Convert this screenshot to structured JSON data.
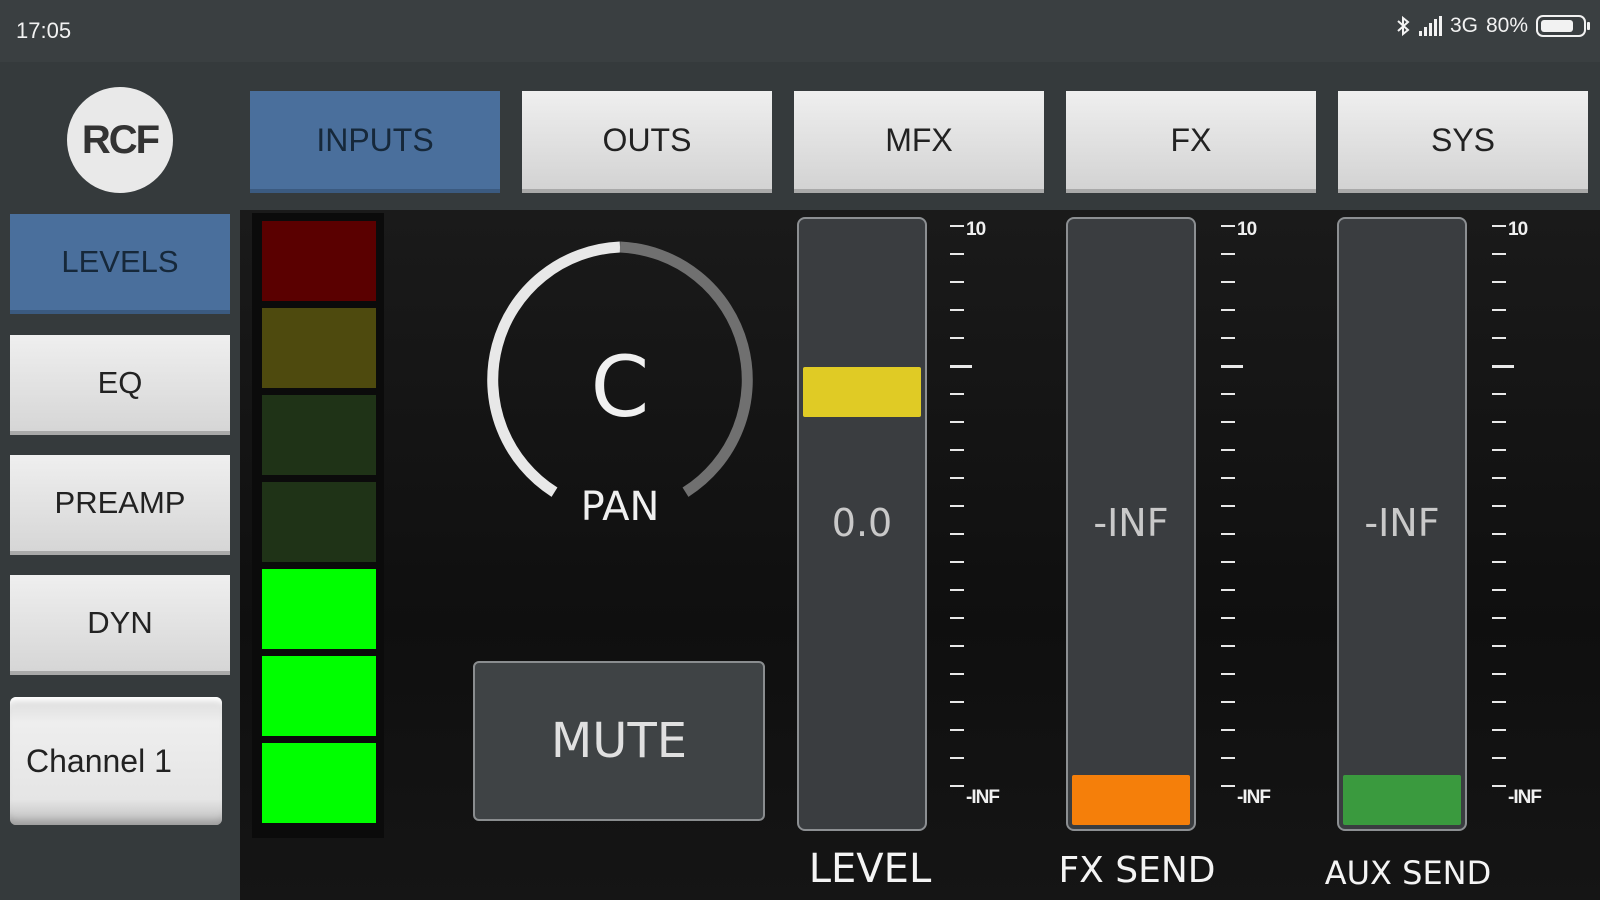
{
  "status_bar": {
    "time": "17:05",
    "network": "3G",
    "battery": "80%",
    "battery_level": 0.8,
    "icons": [
      "bluetooth-icon",
      "signal-icon",
      "battery-icon"
    ]
  },
  "logo": {
    "text": "RCF"
  },
  "tabs": [
    {
      "label": "INPUTS",
      "active": true
    },
    {
      "label": "OUTS",
      "active": false
    },
    {
      "label": "MFX",
      "active": false
    },
    {
      "label": "FX",
      "active": false
    },
    {
      "label": "SYS",
      "active": false
    }
  ],
  "side_menu": [
    {
      "label": "LEVELS",
      "active": true
    },
    {
      "label": "EQ",
      "active": false
    },
    {
      "label": "PREAMP",
      "active": false
    },
    {
      "label": "DYN",
      "active": false
    }
  ],
  "channel": {
    "label": "Channel 1"
  },
  "meter": {
    "segment_colors_top_to_bottom": [
      "#5a0000",
      "#4e4a0e",
      "#1f3317",
      "#1f3317",
      "#00ff00",
      "#00ff00",
      "#00ff00"
    ],
    "lit_segments": 3,
    "total_segments": 7
  },
  "pan": {
    "value": "C",
    "label": "PAN"
  },
  "mute": {
    "label": "MUTE"
  },
  "faders": [
    {
      "label": "LEVEL",
      "value": "0.0",
      "position": 0.74,
      "handle_color": "#e0cb25",
      "scale_top": "10",
      "scale_bottom": "-INF"
    },
    {
      "label": "FX SEND",
      "value": "-INF",
      "position": 0.0,
      "handle_color": "#f57f0a",
      "scale_top": "10",
      "scale_bottom": "-INF"
    },
    {
      "label": "AUX SEND",
      "value": "-INF",
      "position": 0.0,
      "handle_color": "#3a9a3e",
      "scale_top": "10",
      "scale_bottom": "-INF"
    }
  ],
  "colors": {
    "accent_blue": "#4a6f9c",
    "background": "#1c1c1c",
    "panel": "#353a3c"
  }
}
